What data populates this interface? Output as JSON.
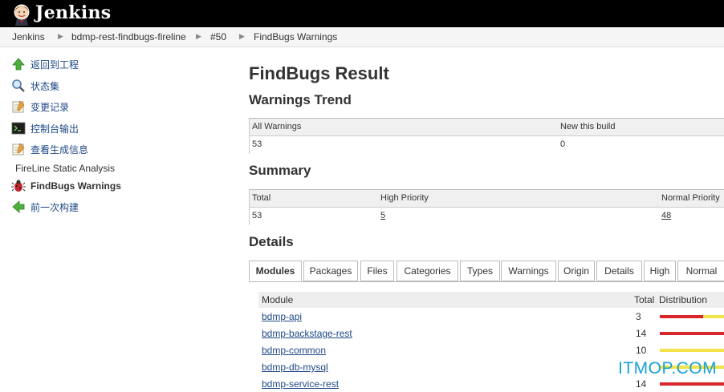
{
  "app": {
    "name": "Jenkins"
  },
  "breadcrumb": [
    "Jenkins",
    "bdmp-rest-findbugs-fireline",
    "#50",
    "FindBugs Warnings"
  ],
  "sidebar": {
    "items": [
      {
        "label": "返回到工程",
        "icon": "up-arrow-icon"
      },
      {
        "label": "状态集",
        "icon": "magnifier-icon"
      },
      {
        "label": "变更记录",
        "icon": "notepad-icon"
      },
      {
        "label": "控制台输出",
        "icon": "terminal-icon"
      },
      {
        "label": "查看生成信息",
        "icon": "notepad-icon"
      },
      {
        "label": "FireLine Static Analysis",
        "icon": ""
      },
      {
        "label": "FindBugs Warnings",
        "icon": "bug-icon"
      },
      {
        "label": "前一次构建",
        "icon": "back-arrow-icon"
      }
    ]
  },
  "main": {
    "title": "FindBugs Result",
    "trend_heading": "Warnings Trend",
    "trend": {
      "headers": [
        "All Warnings",
        "New this build"
      ],
      "values": [
        "53",
        "0"
      ]
    },
    "summary_heading": "Summary",
    "summary": {
      "headers": [
        "Total",
        "High Priority",
        "Normal Priority"
      ],
      "values": [
        "53",
        "5",
        "48"
      ]
    },
    "details_heading": "Details",
    "tabs": [
      "Modules",
      "Packages",
      "Files",
      "Categories",
      "Types",
      "Warnings",
      "Origin",
      "Details",
      "High",
      "Normal"
    ],
    "modules": {
      "headers": [
        "Module",
        "Total",
        "Distribution"
      ],
      "rows": [
        {
          "name": "bdmp-api",
          "total": "3",
          "high_fraction": 0.67
        },
        {
          "name": "bdmp-backstage-rest",
          "total": "14",
          "high_fraction": 1.0
        },
        {
          "name": "bdmp-common",
          "total": "10",
          "high_fraction": 0.0
        },
        {
          "name": "bdmp-db-mysql",
          "total": "",
          "high_fraction": 0.0
        },
        {
          "name": "bdmp-service-rest",
          "total": "14",
          "high_fraction": 1.0
        }
      ]
    }
  },
  "watermark": "ITMOP.COM",
  "colors": {
    "high": "#d9262c",
    "normal": "#f2e34a",
    "link": "#204a87"
  }
}
